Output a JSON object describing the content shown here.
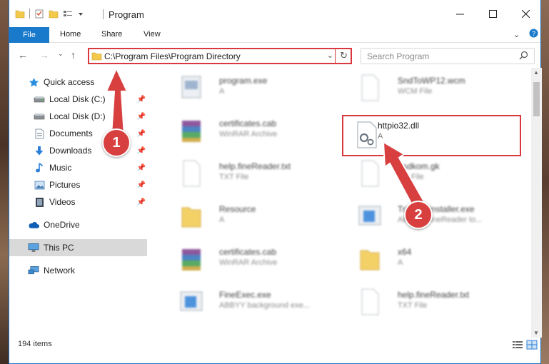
{
  "window": {
    "title": "Program"
  },
  "ribbon": {
    "file": "File",
    "home": "Home",
    "share": "Share",
    "view": "View"
  },
  "address": {
    "path": "C:\\Program Files\\Program Directory",
    "search_placeholder": "Search Program"
  },
  "sidebar": {
    "items": [
      {
        "label": "Quick access",
        "icon": "star-icon",
        "pinned": false
      },
      {
        "label": "Local Disk (C:)",
        "icon": "drive-icon",
        "pinned": true
      },
      {
        "label": "Local Disk (D:)",
        "icon": "drive-icon",
        "pinned": true
      },
      {
        "label": "Documents",
        "icon": "documents-icon",
        "pinned": true
      },
      {
        "label": "Downloads",
        "icon": "download-icon",
        "pinned": true
      },
      {
        "label": "Music",
        "icon": "music-icon",
        "pinned": true
      },
      {
        "label": "Pictures",
        "icon": "pictures-icon",
        "pinned": true
      },
      {
        "label": "Videos",
        "icon": "videos-icon",
        "pinned": true
      },
      {
        "label": "OneDrive",
        "icon": "cloud-icon",
        "pinned": false
      },
      {
        "label": "This PC",
        "icon": "pc-icon",
        "pinned": false,
        "selected": true
      },
      {
        "label": "Network",
        "icon": "network-icon",
        "pinned": false
      }
    ]
  },
  "files": [
    {
      "name": "program.exe",
      "type": "A",
      "icon": "exe-icon"
    },
    {
      "name": "SndToWP12.wcm",
      "type": "WCM File",
      "icon": "blank-file-icon"
    },
    {
      "name": "certificates.cab",
      "type": "WinRAR Archive",
      "icon": "winrar-icon"
    },
    {
      "name": "httpio32.dll",
      "type": "A",
      "icon": "dll-gear-icon",
      "highlighted": true
    },
    {
      "name": "help.fineReader.txt",
      "type": "TXT File",
      "icon": "blank-file-icon"
    },
    {
      "name": "Fsdkom.gk",
      "type": "GK File",
      "icon": "blank-file-icon"
    },
    {
      "name": "Resource",
      "type": "A",
      "icon": "folder-icon"
    },
    {
      "name": "Trigger_installer.exe",
      "type": "ABBYY FineReader to...",
      "icon": "installer-icon"
    },
    {
      "name": "certificates.cab",
      "type": "WinRAR Archive",
      "icon": "winrar-icon"
    },
    {
      "name": "x64",
      "type": "A",
      "icon": "folder-icon"
    },
    {
      "name": "FineExec.exe",
      "type": "ABBYY background exe...",
      "icon": "installer-icon"
    },
    {
      "name": "help.fineReader.txt",
      "type": "TXT File",
      "icon": "blank-file-icon"
    }
  ],
  "status": {
    "item_count": "194 items"
  },
  "markers": {
    "one": "1",
    "two": "2"
  },
  "colors": {
    "accent": "#1979ca",
    "highlight": "#d9383d",
    "selection": "#d9d9d9"
  }
}
